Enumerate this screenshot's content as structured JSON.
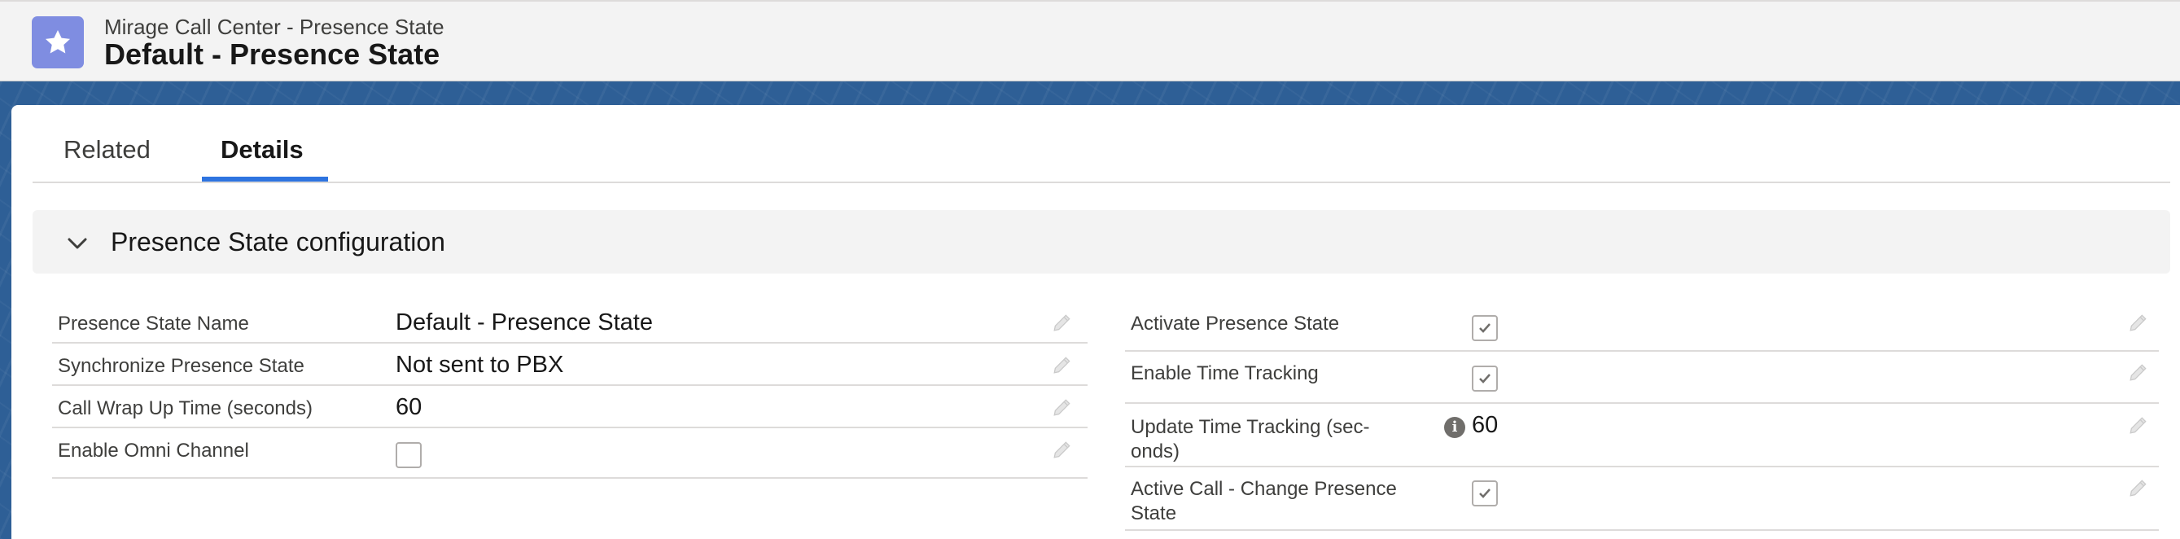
{
  "header": {
    "subtitle": "Mirage Call Center - Presence State",
    "title": "Default - Presence State",
    "icon": "star-icon",
    "icon_color": "#7f8de1"
  },
  "tabs": [
    {
      "label": "Related",
      "active": false
    },
    {
      "label": "Details",
      "active": true
    }
  ],
  "section": {
    "title": "Presence State configuration",
    "expanded": true
  },
  "left_fields": [
    {
      "label": "Presence State Name",
      "value": "Default - Presence State",
      "type": "text"
    },
    {
      "label": "Synchronize Presence State",
      "value": "Not sent to PBX",
      "type": "text"
    },
    {
      "label": "Call Wrap Up Time (seconds)",
      "value": "60",
      "type": "text"
    },
    {
      "label": "Enable Omni Channel",
      "checked": false,
      "type": "checkbox"
    }
  ],
  "right_fields": [
    {
      "label": "Activate Presence State",
      "checked": true,
      "type": "checkbox"
    },
    {
      "label": "Enable Time Tracking",
      "checked": true,
      "type": "checkbox"
    },
    {
      "label_line1": "Update Time Tracking (sec-",
      "label_line2": "onds)",
      "value": "60",
      "type": "text",
      "has_info_icon": true
    },
    {
      "label_line1": "Active Call - Change Presence",
      "label_line2": "State",
      "checked": true,
      "type": "checkbox"
    }
  ],
  "colors": {
    "accent": "#2e74e0",
    "band": "#2e5f96"
  }
}
